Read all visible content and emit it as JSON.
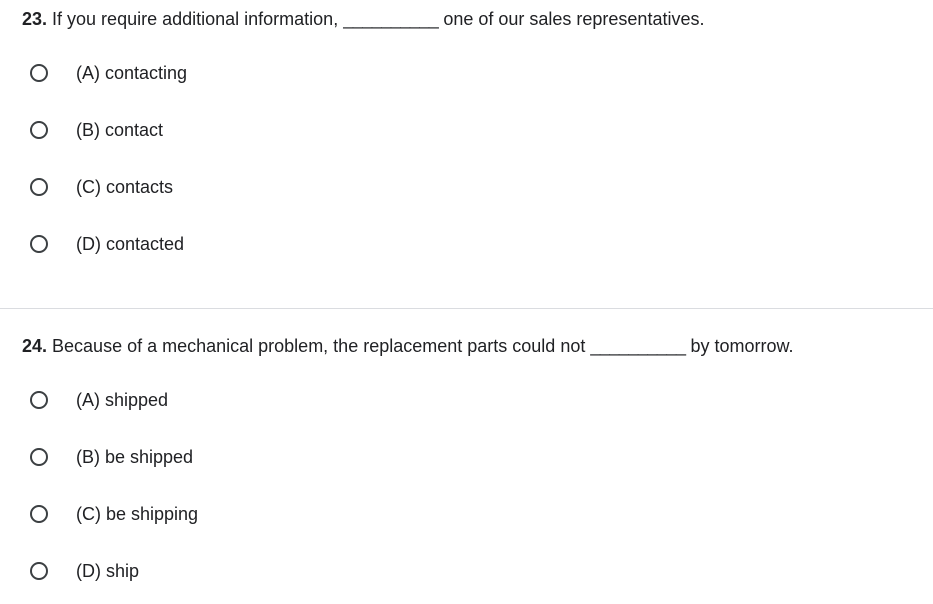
{
  "questions": [
    {
      "number": "23.",
      "text_before": " If you require additional information, ",
      "blank": "__________",
      "text_after": " one of our sales representatives.",
      "options": [
        {
          "label": "(A) contacting"
        },
        {
          "label": "(B) contact"
        },
        {
          "label": "(C) contacts"
        },
        {
          "label": "(D) contacted"
        }
      ]
    },
    {
      "number": "24.",
      "text_before": " Because of a mechanical problem, the replacement parts could not ",
      "blank": "__________",
      "text_after": " by tomorrow.",
      "options": [
        {
          "label": "(A) shipped"
        },
        {
          "label": "(B) be shipped"
        },
        {
          "label": "(C) be shipping"
        },
        {
          "label": "(D) ship"
        }
      ]
    }
  ],
  "colors": {
    "text": "#202124",
    "radio_border": "#3c4043",
    "divider": "#dadce0",
    "background": "#ffffff"
  },
  "icons": {
    "radio": "radio-unchecked-icon"
  }
}
